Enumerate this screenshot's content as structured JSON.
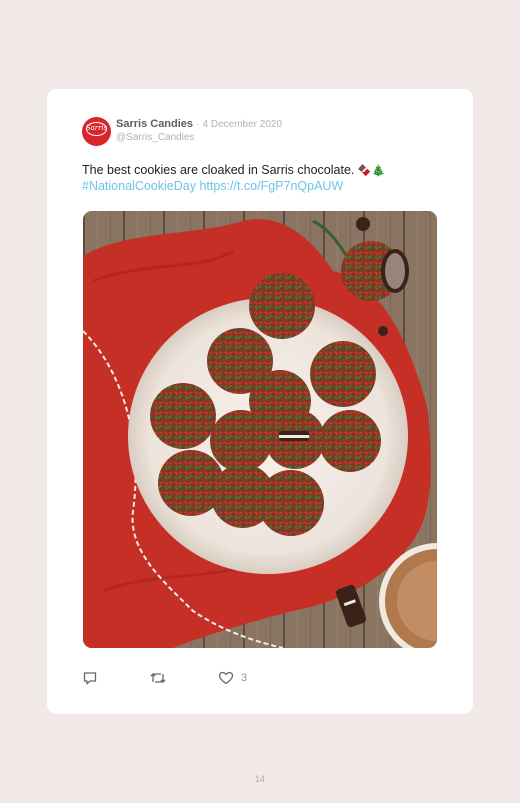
{
  "tweet": {
    "author_name": "Sarris Candies",
    "separator": "·",
    "date": "4 December 2020",
    "handle": "@Sarris_Candies",
    "avatar_logo_text": "Sarris",
    "text_main": "The best cookies are cloaked in Sarris chocolate.",
    "emoji": "🍫🎄",
    "hashtag": "#NationalCookieDay",
    "url": "https://t.co/FgP7nQpAUW",
    "image_alt": "Plate of chocolate-covered cookies with red and green sprinkles on a red cloth",
    "like_count": "3"
  },
  "icons": {
    "reply": "reply-icon",
    "retweet": "retweet-icon",
    "like": "heart-icon"
  },
  "colors": {
    "background": "#f1e9e7",
    "card": "#ffffff",
    "link": "#6cc4e8",
    "brand_red": "#d8262c"
  },
  "page": {
    "number": "14"
  }
}
